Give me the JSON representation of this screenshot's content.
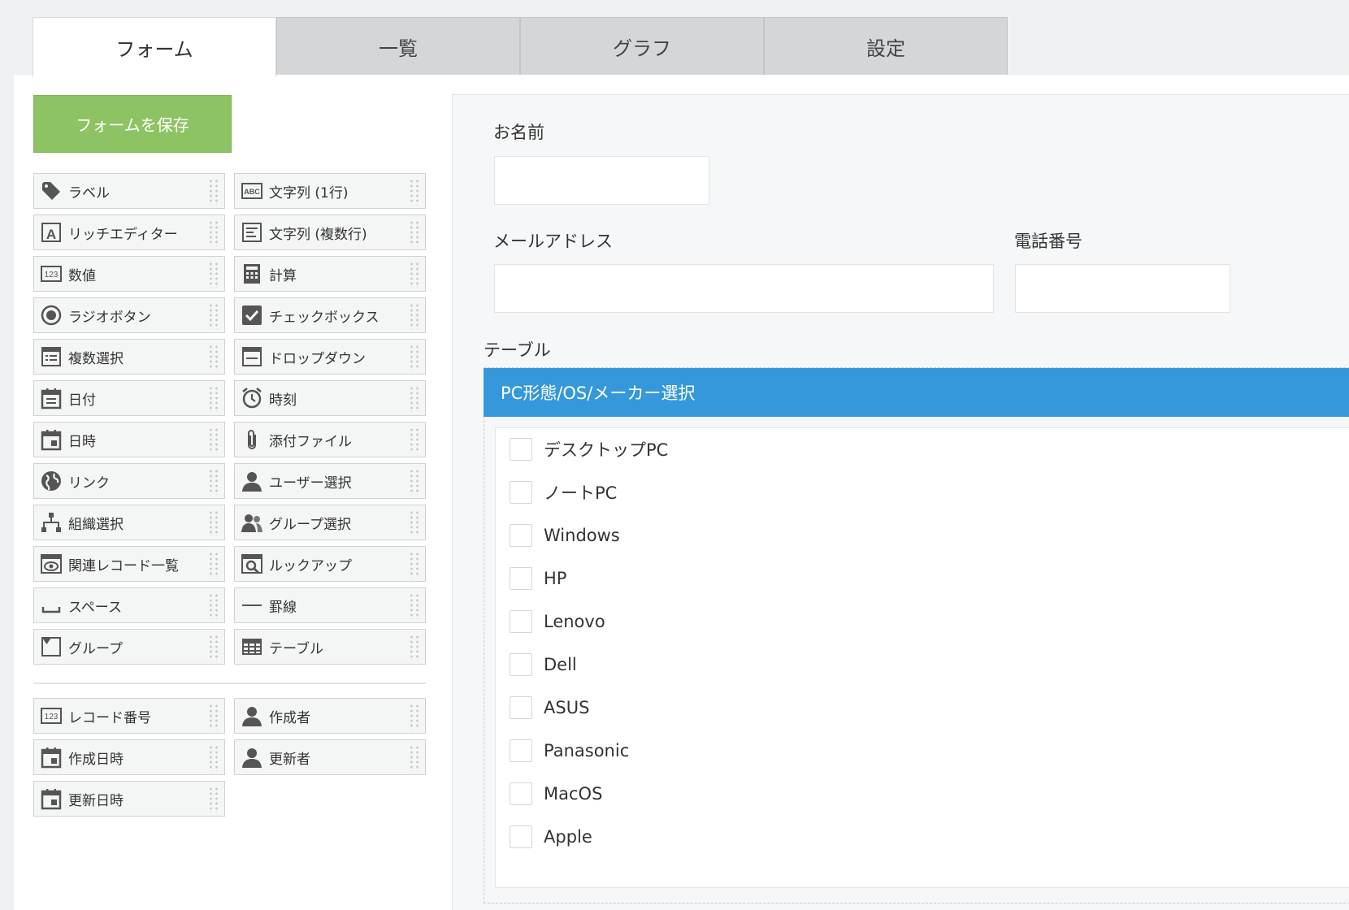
{
  "tabs": [
    {
      "label": "フォーム",
      "active": true
    },
    {
      "label": "一覧",
      "active": false
    },
    {
      "label": "グラフ",
      "active": false
    },
    {
      "label": "設定",
      "active": false
    }
  ],
  "save_button": "フォームを保存",
  "palette": [
    {
      "label": "ラベル",
      "icon": "tag-icon"
    },
    {
      "label": "文字列 (1行)",
      "icon": "abc-icon"
    },
    {
      "label": "リッチエディター",
      "icon": "rich-editor-icon"
    },
    {
      "label": "文字列 (複数行)",
      "icon": "multiline-text-icon"
    },
    {
      "label": "数値",
      "icon": "number-icon"
    },
    {
      "label": "計算",
      "icon": "calculator-icon"
    },
    {
      "label": "ラジオボタン",
      "icon": "radio-icon"
    },
    {
      "label": "チェックボックス",
      "icon": "checkbox-icon"
    },
    {
      "label": "複数選択",
      "icon": "multi-select-icon"
    },
    {
      "label": "ドロップダウン",
      "icon": "dropdown-icon"
    },
    {
      "label": "日付",
      "icon": "calendar-icon"
    },
    {
      "label": "時刻",
      "icon": "clock-icon"
    },
    {
      "label": "日時",
      "icon": "datetime-icon"
    },
    {
      "label": "添付ファイル",
      "icon": "paperclip-icon"
    },
    {
      "label": "リンク",
      "icon": "globe-icon"
    },
    {
      "label": "ユーザー選択",
      "icon": "user-icon"
    },
    {
      "label": "組織選択",
      "icon": "org-chart-icon"
    },
    {
      "label": "グループ選択",
      "icon": "group-icon"
    },
    {
      "label": "関連レコード一覧",
      "icon": "related-records-icon"
    },
    {
      "label": "ルックアップ",
      "icon": "lookup-icon"
    },
    {
      "label": "スペース",
      "icon": "space-icon"
    },
    {
      "label": "罫線",
      "icon": "line-icon"
    },
    {
      "label": "グループ",
      "icon": "group-field-icon"
    },
    {
      "label": "テーブル",
      "icon": "table-icon"
    }
  ],
  "palette_system": [
    {
      "label": "レコード番号",
      "icon": "number-icon"
    },
    {
      "label": "作成者",
      "icon": "user-icon"
    },
    {
      "label": "作成日時",
      "icon": "datetime-icon"
    },
    {
      "label": "更新者",
      "icon": "user-icon"
    },
    {
      "label": "更新日時",
      "icon": "datetime-icon"
    }
  ],
  "form": {
    "name_label": "お名前",
    "email_label": "メールアドレス",
    "phone_label": "電話番号",
    "table_label": "テーブル",
    "table_header": "PC形態/OS/メーカー選択",
    "options": [
      "デスクトップPC",
      "ノートPC",
      "Windows",
      "HP",
      "Lenovo",
      "Dell",
      "ASUS",
      "Panasonic",
      "MacOS",
      "Apple"
    ]
  }
}
